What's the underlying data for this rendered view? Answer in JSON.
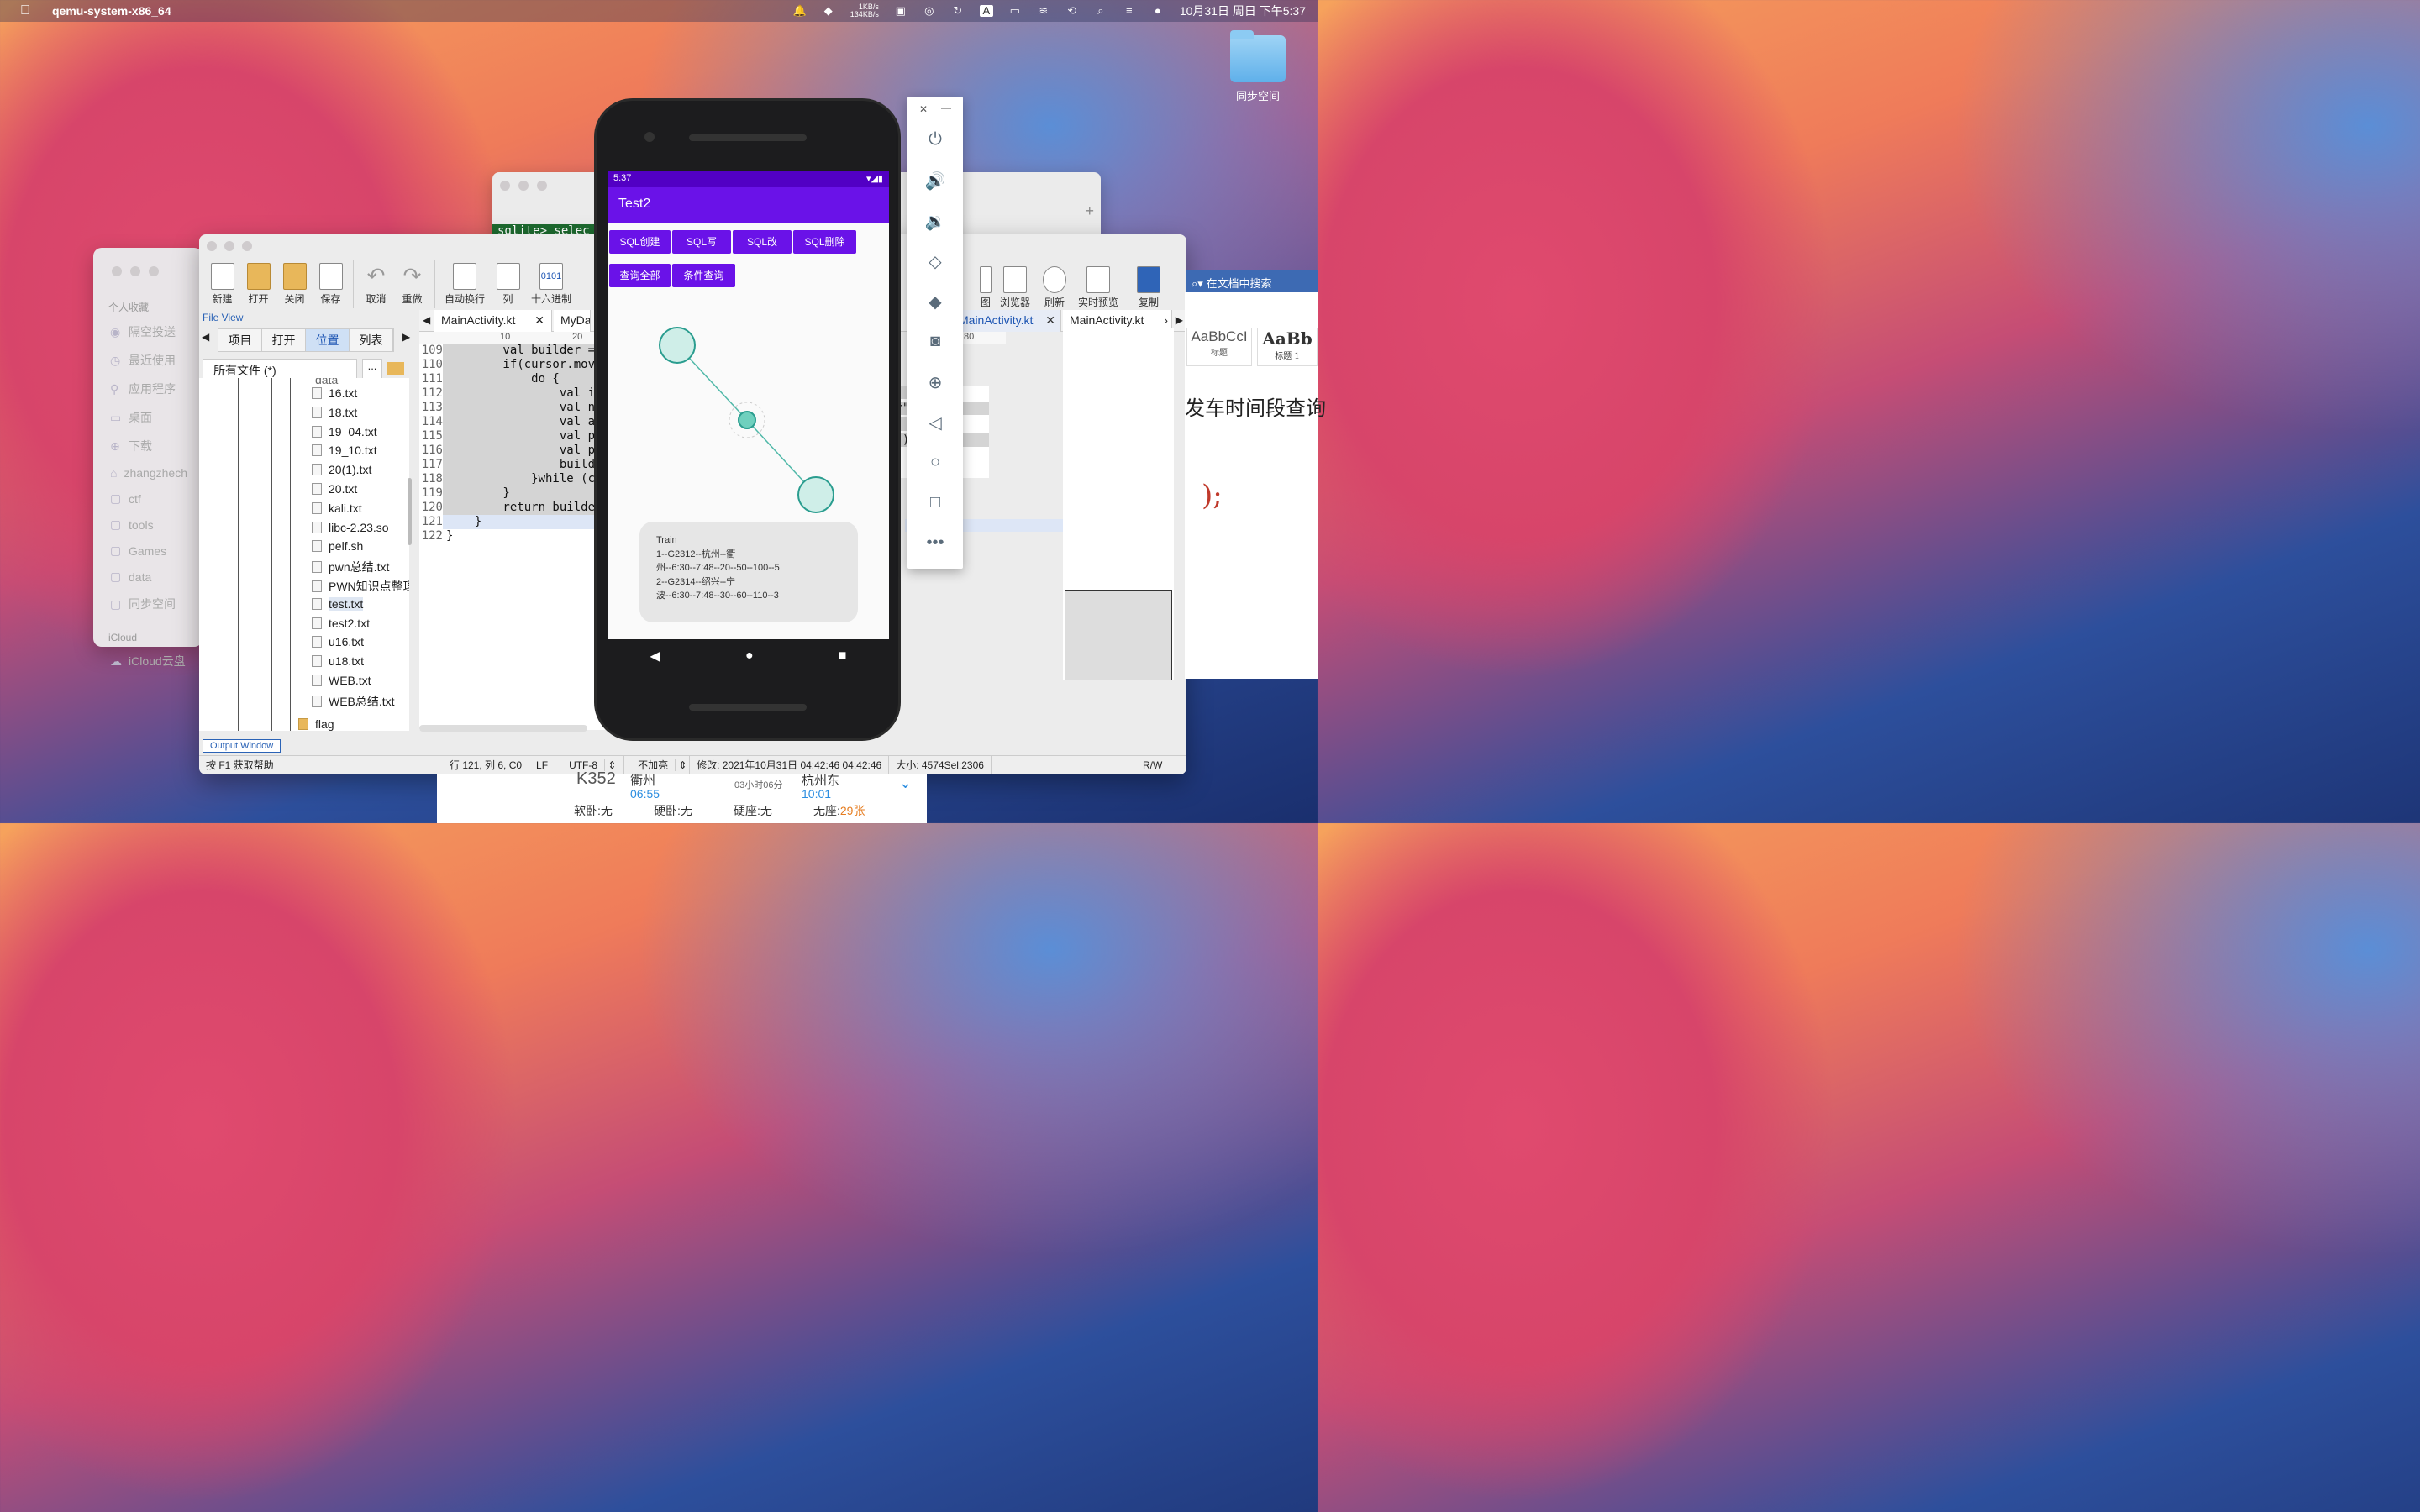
{
  "menubar": {
    "app": "qemu-system-x86_64",
    "net_up": "1KB/s",
    "net_down": "134KB/s",
    "ime": "A",
    "datetime": "10月31日 周日 下午5:37"
  },
  "desktop": {
    "folder_label": "同步空间"
  },
  "finder": {
    "section_fav": "个人收藏",
    "items": [
      "隔空投送",
      "最近使用",
      "应用程序",
      "桌面",
      "下载",
      "zhangzhech",
      "ctf",
      "tools",
      "Games",
      "data",
      "同步空间"
    ],
    "section_icloud": "iCloud",
    "icloud_item": "iCloud云盘"
  },
  "terminal": {
    "prompt": "sqlite> selec"
  },
  "editor": {
    "toolbar": [
      "新建",
      "打开",
      "关闭",
      "保存",
      "取消",
      "重做",
      "自动换行",
      "列",
      "十六进制"
    ],
    "toolbar_right": [
      "图",
      "浏览器",
      "刷新",
      "实时预览",
      "复制"
    ],
    "hex_label": "0101",
    "fileview_title": "File View",
    "fv_tabs": [
      "项目",
      "打开",
      "位置",
      "列表"
    ],
    "filter": "所有文件 (*)",
    "filter_btn": "...",
    "tree_top": "data",
    "files": [
      "16.txt",
      "18.txt",
      "19_04.txt",
      "19_10.txt",
      "20(1).txt",
      "20.txt",
      "kali.txt",
      "libc-2.23.so",
      "pelf.sh",
      "pwn总结.txt",
      "PWN知识点整理",
      "test.txt",
      "test2.txt",
      "u16.txt",
      "u18.txt",
      "WEB.txt",
      "WEB总结.txt"
    ],
    "folder_bottom": "flag",
    "tabs": [
      "MainActivity.kt",
      "MyDa",
      "MainActivity.kt",
      "MainActivity.kt"
    ],
    "ruler_marks": [
      "10",
      "20",
      "80"
    ],
    "line_numbers": [
      "109",
      "110",
      "111",
      "112",
      "113",
      "114",
      "115",
      "116",
      "117",
      "118",
      "119",
      "120",
      "121",
      "122"
    ],
    "code_lines": [
      "        val builder =",
      "        if(cursor.mov",
      "            do {",
      "                val i",
      "                val n",
      "                val a",
      "                val p",
      "                val p",
      "                build",
      "            }while (c",
      "        }",
      "        return builde",
      "    }",
      "}"
    ],
    "right_code": [
      "\")",
      "or\"))",
      "\")",
      "e\"))"
    ],
    "output_tab": "Output Window",
    "help": "按 F1 获取帮助",
    "status": [
      "行 121, 列 6, C0",
      "LF",
      "UTF-8",
      "不加亮",
      "修改: 2021年10月31日 04:42:46 04:42:46",
      "大小: 4574Sel:2306",
      "R/W"
    ]
  },
  "search": {
    "placeholder": "在文档中搜索"
  },
  "ribbon": {
    "style1": "AaBbCcI",
    "style1_name": "标题",
    "style2": "AaBb",
    "style2_name": "标题 1",
    "doc_text": "发车时间段查询",
    "doc_text2": ");"
  },
  "phone": {
    "time": "5:37",
    "title": "Test2",
    "buttons": [
      "SQL创建",
      "SQL写",
      "SQL改",
      "SQL删除",
      "查询全部",
      "条件查询"
    ],
    "card": [
      "Train",
      "1--G2312--杭州--衢",
      "州--6:30--7:48--20--50--100--5",
      "2--G2314--绍兴--宁",
      "波--6:30--7:48--30--60--110--3"
    ]
  },
  "ticket": {
    "train": "K352",
    "from": "衢州",
    "from_time": "06:55",
    "duration": "03小时06分",
    "to": "杭州东",
    "to_time": "10:01",
    "seat1": "软卧:无",
    "seat2": "硬卧:无",
    "seat3": "硬座:无",
    "seat4_label": "无座:",
    "seat4_val": "29张"
  }
}
